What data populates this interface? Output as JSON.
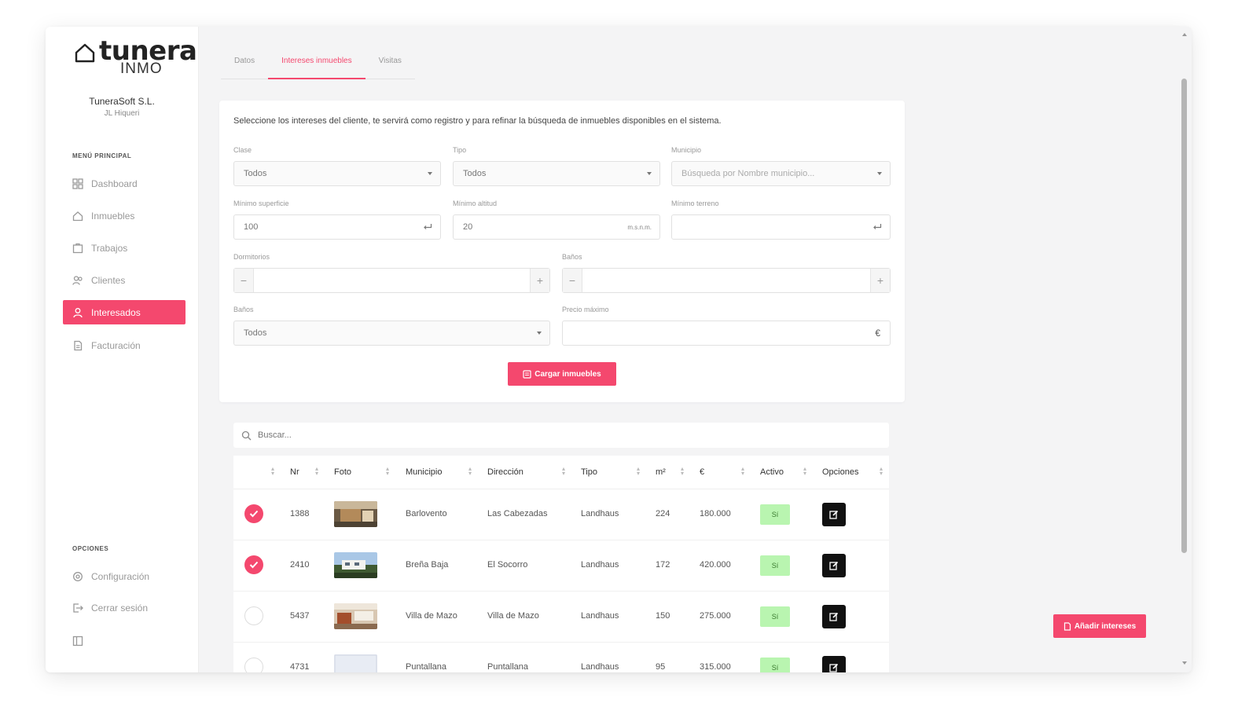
{
  "brand": {
    "name": "tunera",
    "sub": "INMO"
  },
  "company": {
    "name": "TuneraSoft S.L.",
    "user": "JL Hiqueri"
  },
  "sidebar": {
    "menu_label": "MENÚ PRINCIPAL",
    "items": [
      {
        "label": "Dashboard",
        "icon": "dashboard-icon"
      },
      {
        "label": "Inmuebles",
        "icon": "home-icon"
      },
      {
        "label": "Trabajos",
        "icon": "trabajos-icon"
      },
      {
        "label": "Clientes",
        "icon": "users-icon"
      },
      {
        "label": "Interesados",
        "icon": "user-icon"
      },
      {
        "label": "Facturación",
        "icon": "invoice-icon"
      }
    ],
    "options_label": "OPCIONES",
    "options": [
      {
        "label": "Configuración",
        "icon": "gear-icon"
      },
      {
        "label": "Cerrar sesión",
        "icon": "logout-icon"
      }
    ]
  },
  "tabs": [
    {
      "label": "Datos"
    },
    {
      "label": "Intereses inmuebles"
    },
    {
      "label": "Visitas"
    }
  ],
  "filters": {
    "intro": "Seleccione los intereses del cliente, te servirá como registro y para refinar la búsqueda de inmuebles disponibles en el sistema.",
    "clase": {
      "label": "Clase",
      "value": "Todos"
    },
    "tipo": {
      "label": "Tipo",
      "value": "Todos"
    },
    "municipio": {
      "label": "Municipio",
      "placeholder": "Búsqueda por Nombre municipio..."
    },
    "min_superficie": {
      "label": "Mínimo superficie",
      "value": "100"
    },
    "min_altitud": {
      "label": "Mínimo altitud",
      "value": "20",
      "unit": "m.s.n.m."
    },
    "min_terreno": {
      "label": "Mínimo terreno",
      "value": ""
    },
    "dormitorios": {
      "label": "Dormitorios",
      "minus": "−",
      "plus": "+"
    },
    "banos": {
      "label": "Baños",
      "minus": "−",
      "plus": "+"
    },
    "banos_select": {
      "label": "Baños",
      "value": "Todos"
    },
    "precio_maximo": {
      "label": "Precio máximo",
      "suffix": "€"
    },
    "load_button": "Cargar inmuebles"
  },
  "search": {
    "placeholder": "Buscar..."
  },
  "table": {
    "headers": {
      "nr": "Nr",
      "foto": "Foto",
      "municipio": "Municipio",
      "direccion": "Dirección",
      "tipo": "Tipo",
      "m2": "m²",
      "precio": "€",
      "activo": "Activo",
      "opciones": "Opciones"
    },
    "rows": [
      {
        "checked": true,
        "nr": "1388",
        "municipio": "Barlovento",
        "direccion": "Las Cabezadas",
        "tipo": "Landhaus",
        "m2": "224",
        "precio": "180.000",
        "activo": "Sí"
      },
      {
        "checked": true,
        "nr": "2410",
        "municipio": "Breña Baja",
        "direccion": "El Socorro",
        "tipo": "Landhaus",
        "m2": "172",
        "precio": "420.000",
        "activo": "Sí"
      },
      {
        "checked": false,
        "nr": "5437",
        "municipio": "Villa de Mazo",
        "direccion": "Villa de Mazo",
        "tipo": "Landhaus",
        "m2": "150",
        "precio": "275.000",
        "activo": "Sí"
      },
      {
        "checked": false,
        "nr": "4731",
        "municipio": "Puntallana",
        "direccion": "Puntallana",
        "tipo": "Landhaus",
        "m2": "95",
        "precio": "315.000",
        "activo": "Sí"
      }
    ]
  },
  "add_interest_button": "Añadir intereses",
  "colors": {
    "accent": "#f4486e",
    "badge": "#b9f5b0",
    "sidebar_bg": "#ffffff",
    "content_bg": "#f4f4f5"
  }
}
